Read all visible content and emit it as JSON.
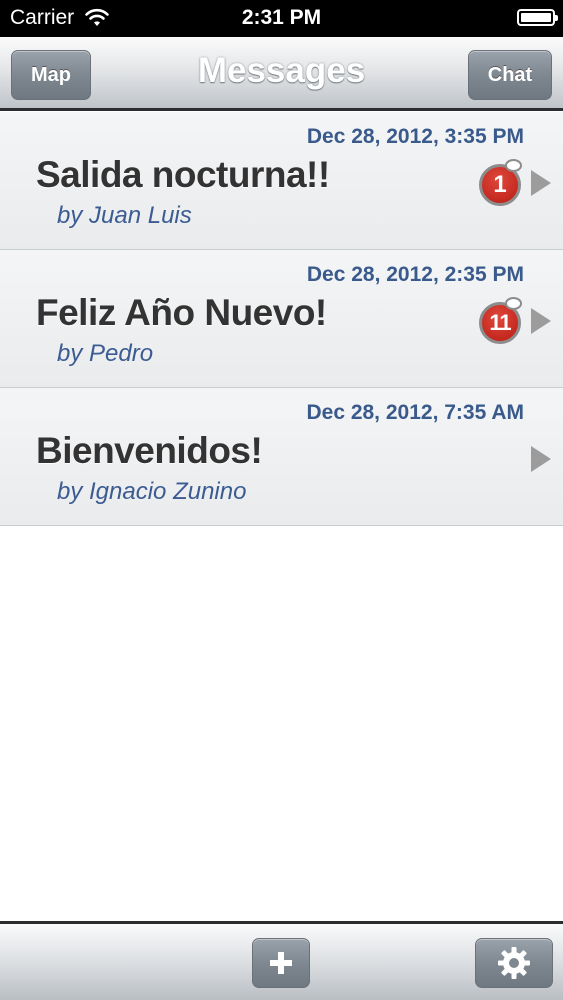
{
  "status_bar": {
    "carrier": "Carrier",
    "time": "2:31 PM"
  },
  "nav": {
    "left_button": "Map",
    "title": "Messages",
    "right_button": "Chat"
  },
  "messages": [
    {
      "date": "Dec 28, 2012, 3:35 PM",
      "title": "Salida nocturna!!",
      "author": "by Juan Luis",
      "unread": "1"
    },
    {
      "date": "Dec 28, 2012, 2:35 PM",
      "title": "Feliz Año Nuevo!",
      "author": "by Pedro",
      "unread": "11"
    },
    {
      "date": "Dec 28, 2012, 7:35 AM",
      "title": "Bienvenidos!",
      "author": "by Ignacio Zunino",
      "unread": null
    }
  ],
  "toolbar": {
    "add_icon": "plus-icon",
    "settings_icon": "gear-icon"
  },
  "colors": {
    "date_text": "#3a5a8c",
    "author_text": "#3b5b92",
    "badge_red": "#c8231a"
  }
}
